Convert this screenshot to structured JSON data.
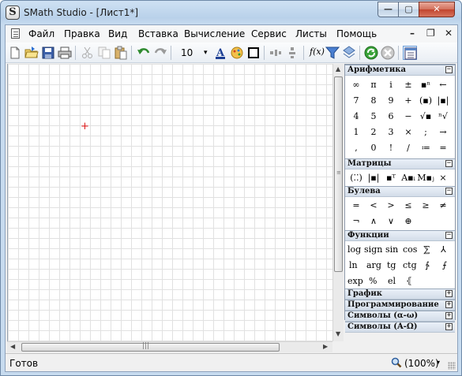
{
  "window": {
    "title": "SMath Studio - [Лист1*]",
    "app_icon_letter": "S",
    "caption": {
      "minimize": "—",
      "maximize": "▢",
      "close": "✕"
    }
  },
  "menubar": {
    "items": [
      "Файл",
      "Правка",
      "Вид",
      "Вставка",
      "Вычисление",
      "Сервис",
      "Листы",
      "Помощь"
    ],
    "mdi": {
      "minimize": "–",
      "restore": "❐",
      "close": "✕"
    }
  },
  "toolbar": {
    "font_size": "10",
    "font_size_arrow": "▾",
    "icons": [
      "new-document",
      "open-folder",
      "save",
      "print",
      "cut",
      "copy",
      "paste",
      "undo",
      "redo",
      "text-color",
      "fill-color",
      "border",
      "align-horizontal",
      "align-vertical",
      "function",
      "filter",
      "plugins",
      "recalculate",
      "stop-calculation",
      "sidebar-toggle"
    ],
    "function_label": "f(x)"
  },
  "status": {
    "text": "Готов",
    "zoom": "(100%)",
    "zoom_arrow": "▾"
  },
  "scrollbars": {
    "up": "▲",
    "down": "▼",
    "left": "◀",
    "right": "▶",
    "vgrip": "≡",
    "hgrip": "|||"
  },
  "panels": {
    "arithmetic": {
      "title": "Арифметика",
      "toggle": "⊟",
      "rows": [
        [
          "∞",
          "π",
          "i",
          "±",
          "▪ⁿ",
          "←"
        ],
        [
          "7",
          "8",
          "9",
          "+",
          "(▪)",
          "|▪|"
        ],
        [
          "4",
          "5",
          "6",
          "−",
          "√▪",
          "ⁿ√"
        ],
        [
          "1",
          "2",
          "3",
          "×",
          ";",
          "→"
        ],
        [
          ",",
          "0",
          "!",
          "/",
          "≔",
          "="
        ]
      ]
    },
    "matrices": {
      "title": "Матрицы",
      "toggle": "⊟",
      "rows": [
        [
          "(⁚⁚)",
          "|▪|",
          "▪ᵀ",
          "A▪ᵢ",
          "M▪ⱼ",
          "⨯"
        ]
      ]
    },
    "boolean": {
      "title": "Булева",
      "toggle": "⊟",
      "rows": [
        [
          "=",
          "<",
          ">",
          "≤",
          "≥",
          "≠"
        ],
        [
          "¬",
          "∧",
          "∨",
          "⊕"
        ]
      ]
    },
    "functions": {
      "title": "Функции",
      "toggle": "⊟",
      "rows": [
        [
          "log",
          "sign",
          "sin",
          "cos",
          "⅀",
          "⅄"
        ],
        [
          "ln",
          "arg",
          "tg",
          "ctg",
          "∱",
          "⨍"
        ],
        [
          "exp",
          "%",
          "el",
          "⦃"
        ]
      ]
    },
    "collapsed": [
      {
        "title": "График",
        "toggle": "⊞"
      },
      {
        "title": "Программирование",
        "toggle": "⊞"
      },
      {
        "title": "Символы (α-ω)",
        "toggle": "⊞"
      },
      {
        "title": "Символы (Α-Ω)",
        "toggle": "⊞"
      }
    ]
  }
}
